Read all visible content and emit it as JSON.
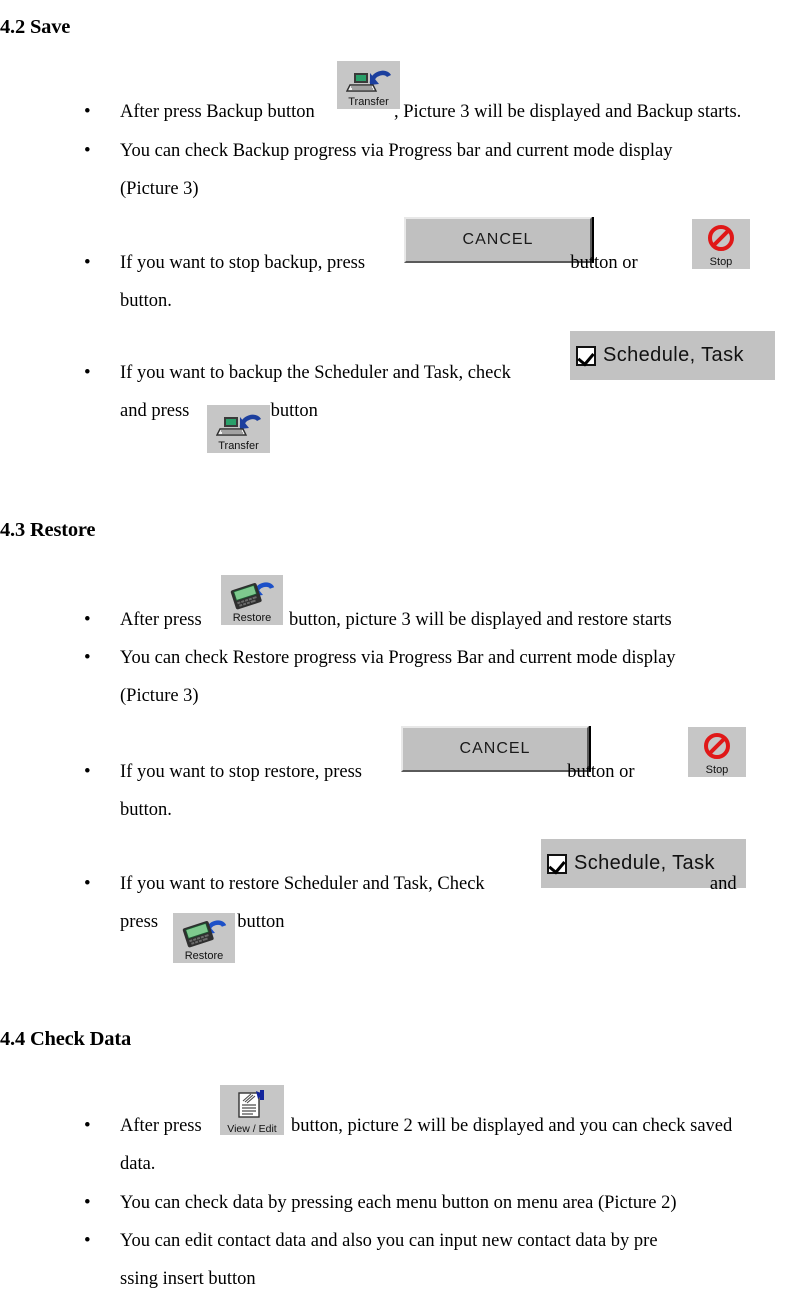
{
  "document": {
    "sections": [
      {
        "id": "save",
        "number": "4.2",
        "heading": "4.2 Save",
        "bullets": [
          {
            "id": "save-b1",
            "text_before": "After press Backup button",
            "text_after": ", Picture 3 will be displayed and Backup starts."
          },
          {
            "id": "save-b2",
            "line1": "You can check Backup progress via Progress bar and current mode display",
            "line2": "(Picture 3)"
          },
          {
            "id": "save-b3",
            "text_before": "If you want to stop backup, press",
            "text_middle": "button or",
            "text_after": "button."
          },
          {
            "id": "save-b4",
            "text_before": "If you want to backup the Scheduler and Task, check",
            "text_middle": "and press",
            "text_after": "button"
          }
        ]
      },
      {
        "id": "restore",
        "number": "4.3",
        "heading": "4.3 Restore",
        "bullets": [
          {
            "id": "restore-b1",
            "text_before": "After press",
            "text_after": "button, picture 3 will be displayed and restore starts"
          },
          {
            "id": "restore-b2",
            "line1": "You can check Restore progress via Progress Bar and current mode display",
            "line2": "(Picture 3)"
          },
          {
            "id": "restore-b3",
            "text_before": "If you want to stop restore, press",
            "text_middle": "button or",
            "text_after": "button."
          },
          {
            "id": "restore-b4",
            "text_before": "If you want to restore Scheduler and Task, Check",
            "text_middle": "and",
            "text_after": "press",
            "text_end": "button"
          }
        ]
      },
      {
        "id": "check-data",
        "number": "4.4",
        "heading": "4.4 Check Data",
        "bullets": [
          {
            "id": "check-b1",
            "text_before": "After press",
            "text_after": "button, picture 2 will be displayed and you can check saved",
            "line2": "data."
          },
          {
            "id": "check-b2",
            "line1": "You can check data by pressing each menu button on menu area (Picture 2)"
          },
          {
            "id": "check-b3",
            "line1": "You  can  edit  contact  data  and  also  you  can  input  new  contact  data  by  pre",
            "line2": "ssing  insert  button"
          }
        ]
      }
    ],
    "bullet_glyph": "•"
  },
  "widgets": {
    "transfer_button": {
      "label": "Transfer",
      "icon": "computer-transfer-icon",
      "background": "#c6c6c6",
      "arrow_color": "#1c3f9e",
      "screen_color": "#2aa06a"
    },
    "restore_button": {
      "label": "Restore",
      "icon": "pda-restore-icon",
      "background": "#c6c6c6",
      "arrow_color": "#1c50c8",
      "screen_color": "#7ec98e"
    },
    "view_edit_button": {
      "label": "View / Edit",
      "icon": "document-edit-icon",
      "background": "#c6c6c6",
      "flag_color": "#12249c"
    },
    "cancel_button": {
      "label": "CANCEL",
      "face_color": "#c0c0c0"
    },
    "stop_button": {
      "label": "Stop",
      "icon": "prohibition-sign-icon",
      "background": "#c6c6c6",
      "sign_color": "#e01818"
    },
    "schedule_task_checkbox": {
      "label": "Schedule, Task",
      "checked": true,
      "background": "#c2c2c2"
    }
  }
}
